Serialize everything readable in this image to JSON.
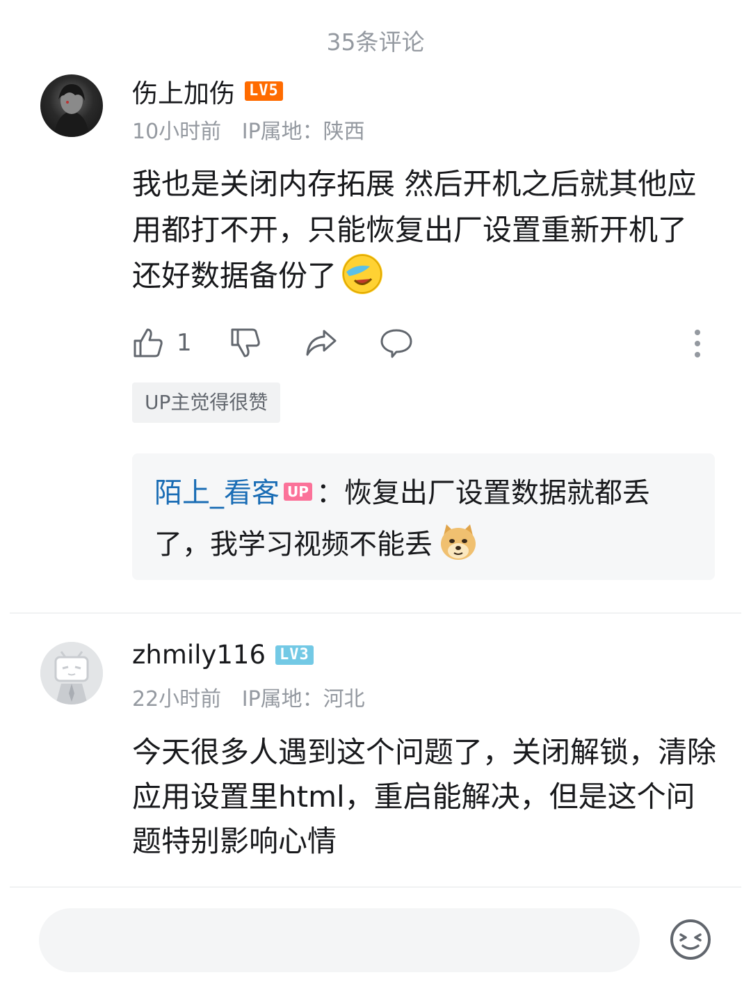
{
  "header": {
    "title": "35条评论"
  },
  "comments": [
    {
      "username": "伤上加伤",
      "level": "LV5",
      "level_color": "#ff6b00",
      "time": "10小时前",
      "ip": "IP属地：陕西",
      "text": "我也是关闭内存拓展 然后开机之后就其他应用都打不开，只能恢复出厂设置重新开机了 还好数据备份了",
      "emoji": "facepalm-laugh-emoji",
      "like_count": "1",
      "tag": "UP主觉得很赞",
      "reply": {
        "name": "陌上_看客",
        "badge": "UP",
        "separator": "：",
        "text": "恢复出厂设置数据就都丢了，我学习视频不能丢",
        "emoji": "doge-emoji"
      }
    },
    {
      "username": "zhmily116",
      "level": "LV3",
      "level_color": "#73c9e5",
      "time": "22小时前",
      "ip": "IP属地：河北",
      "text": "今天很多人遇到这个问题了，关闭解锁，清除应用设置里html，重启能解决，但是这个问题特别影响心情"
    }
  ],
  "icons": {
    "like": "thumbs-up-icon",
    "dislike": "thumbs-down-icon",
    "share": "share-icon",
    "reply": "comment-bubble-icon",
    "more": "more-vertical-icon",
    "emoji_button": "emoji-icon"
  }
}
